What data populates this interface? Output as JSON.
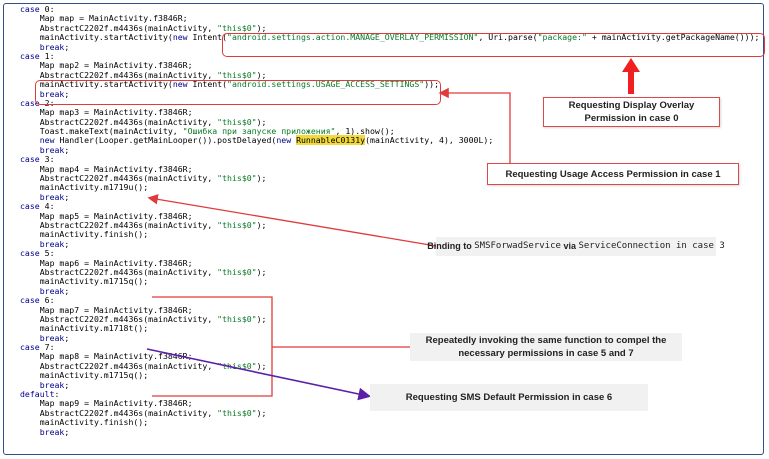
{
  "code_lines": [
    [
      {
        "t": "case",
        "c": "kw"
      },
      {
        "t": " 0:"
      }
    ],
    [
      {
        "t": "    Map map = MainActivity.f3846R;"
      }
    ],
    [
      {
        "t": "    AbstractC2202f.m4436s(mainActivity, "
      },
      {
        "t": "\"this$0\"",
        "c": "str"
      },
      {
        "t": ");"
      }
    ],
    [
      {
        "t": "    mainActivity.startActivity("
      },
      {
        "t": "new",
        "c": "kw"
      },
      {
        "t": " Intent("
      },
      {
        "t": "\"android.settings.action.MANAGE_OVERLAY_PERMISSION\"",
        "c": "str"
      },
      {
        "t": ", Uri.parse("
      },
      {
        "t": "\"package:\"",
        "c": "str"
      },
      {
        "t": " + mainActivity.getPackageName()));"
      }
    ],
    [
      {
        "t": "    "
      },
      {
        "t": "break",
        "c": "kw"
      },
      {
        "t": ";"
      }
    ],
    [
      {
        "t": "case",
        "c": "kw"
      },
      {
        "t": " 1:"
      }
    ],
    [
      {
        "t": "    Map map2 = MainActivity.f3846R;"
      }
    ],
    [
      {
        "t": "    AbstractC2202f.m4436s(mainActivity, "
      },
      {
        "t": "\"this$0\"",
        "c": "str"
      },
      {
        "t": ");"
      }
    ],
    [
      {
        "t": "    mainActivity.startActivity("
      },
      {
        "t": "new",
        "c": "kw"
      },
      {
        "t": " Intent("
      },
      {
        "t": "\"android.settings.USAGE_ACCESS_SETTINGS\"",
        "c": "str"
      },
      {
        "t": "));"
      }
    ],
    [
      {
        "t": "    "
      },
      {
        "t": "break",
        "c": "kw"
      },
      {
        "t": ";"
      }
    ],
    [
      {
        "t": "case",
        "c": "kw"
      },
      {
        "t": " 2:"
      }
    ],
    [
      {
        "t": "    Map map3 = MainActivity.f3846R;"
      }
    ],
    [
      {
        "t": "    AbstractC2202f.m4436s(mainActivity, "
      },
      {
        "t": "\"this$0\"",
        "c": "str"
      },
      {
        "t": ");"
      }
    ],
    [
      {
        "t": "    Toast.makeText(mainActivity, "
      },
      {
        "t": "\"Ошибка при запуске приложения\"",
        "c": "str"
      },
      {
        "t": ", 1).show();"
      }
    ],
    [
      {
        "t": "    "
      },
      {
        "t": "new",
        "c": "kw"
      },
      {
        "t": " Handler(Looper.getMainLooper()).postDelayed("
      },
      {
        "t": "new",
        "c": "kw"
      },
      {
        "t": " "
      },
      {
        "t": "RunnableC0131y",
        "c": "hl"
      },
      {
        "t": "(mainActivity, 4), 3000L);"
      }
    ],
    [
      {
        "t": "    "
      },
      {
        "t": "break",
        "c": "kw"
      },
      {
        "t": ";"
      }
    ],
    [
      {
        "t": "case",
        "c": "kw"
      },
      {
        "t": " 3:"
      }
    ],
    [
      {
        "t": "    Map map4 = MainActivity.f3846R;"
      }
    ],
    [
      {
        "t": "    AbstractC2202f.m4436s(mainActivity, "
      },
      {
        "t": "\"this$0\"",
        "c": "str"
      },
      {
        "t": ");"
      }
    ],
    [
      {
        "t": "    mainActivity.m1719u();"
      }
    ],
    [
      {
        "t": "    "
      },
      {
        "t": "break",
        "c": "kw"
      },
      {
        "t": ";"
      }
    ],
    [
      {
        "t": "case",
        "c": "kw"
      },
      {
        "t": " 4:"
      }
    ],
    [
      {
        "t": "    Map map5 = MainActivity.f3846R;"
      }
    ],
    [
      {
        "t": "    AbstractC2202f.m4436s(mainActivity, "
      },
      {
        "t": "\"this$0\"",
        "c": "str"
      },
      {
        "t": ");"
      }
    ],
    [
      {
        "t": "    mainActivity.finish();"
      }
    ],
    [
      {
        "t": "    "
      },
      {
        "t": "break",
        "c": "kw"
      },
      {
        "t": ";"
      }
    ],
    [
      {
        "t": "case",
        "c": "kw"
      },
      {
        "t": " 5:"
      }
    ],
    [
      {
        "t": "    Map map6 = MainActivity.f3846R;"
      }
    ],
    [
      {
        "t": "    AbstractC2202f.m4436s(mainActivity, "
      },
      {
        "t": "\"this$0\"",
        "c": "str"
      },
      {
        "t": ");"
      }
    ],
    [
      {
        "t": "    mainActivity.m1715q();"
      }
    ],
    [
      {
        "t": "    "
      },
      {
        "t": "break",
        "c": "kw"
      },
      {
        "t": ";"
      }
    ],
    [
      {
        "t": "case",
        "c": "kw"
      },
      {
        "t": " 6:"
      }
    ],
    [
      {
        "t": "    Map map7 = MainActivity.f3846R;"
      }
    ],
    [
      {
        "t": "    AbstractC2202f.m4436s(mainActivity, "
      },
      {
        "t": "\"this$0\"",
        "c": "str"
      },
      {
        "t": ");"
      }
    ],
    [
      {
        "t": "    mainActivity.m1718t();"
      }
    ],
    [
      {
        "t": "    "
      },
      {
        "t": "break",
        "c": "kw"
      },
      {
        "t": ";"
      }
    ],
    [
      {
        "t": "case",
        "c": "kw"
      },
      {
        "t": " 7:"
      }
    ],
    [
      {
        "t": "    Map map8 = MainActivity.f3846R;"
      }
    ],
    [
      {
        "t": "    AbstractC2202f.m4436s(mainActivity, "
      },
      {
        "t": "\"this$0\"",
        "c": "str"
      },
      {
        "t": ");"
      }
    ],
    [
      {
        "t": "    mainActivity.m1715q();"
      }
    ],
    [
      {
        "t": "    "
      },
      {
        "t": "break",
        "c": "kw"
      },
      {
        "t": ";"
      }
    ],
    [
      {
        "t": "default",
        "c": "kw"
      },
      {
        "t": ":"
      }
    ],
    [
      {
        "t": "    Map map9 = MainActivity.f3846R;"
      }
    ],
    [
      {
        "t": "    AbstractC2202f.m4436s(mainActivity, "
      },
      {
        "t": "\"this$0\"",
        "c": "str"
      },
      {
        "t": ");"
      }
    ],
    [
      {
        "t": "    mainActivity.finish();"
      }
    ],
    [
      {
        "t": "    "
      },
      {
        "t": "break",
        "c": "kw"
      },
      {
        "t": ";"
      }
    ]
  ],
  "callouts": {
    "overlay": "Requesting Display Overlay Permission in case 0",
    "usage": "Requesting Usage Access Permission in case 1",
    "binding_prefix": "Binding to ",
    "binding_service": "SMSForwadService",
    "binding_mid": " via ",
    "binding_conn": "ServiceConnection",
    "binding_suffix": " in case 3",
    "repeat": "Repeatedly invoking the same function to compel the necessary permissions in case 5 and 7",
    "sms_default": "Requesting SMS Default Permission in case 6"
  },
  "colors": {
    "keyword": "#00008b",
    "string": "#0a7a26",
    "highlight": "#f2d93c",
    "annotation_red": "#e03b3b",
    "arrow_purple": "#5b1fa8",
    "frame": "#2f4f86"
  }
}
